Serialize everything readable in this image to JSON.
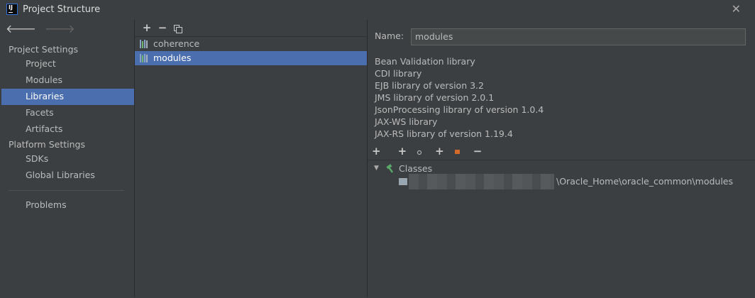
{
  "window": {
    "title": "Project Structure",
    "logo_text": "IJ"
  },
  "nav": {
    "back_icon": "arrow-left-icon",
    "forward_icon": "arrow-right-icon"
  },
  "sidebar": {
    "project_settings_header": "Project Settings",
    "project_settings_items": [
      {
        "label": "Project"
      },
      {
        "label": "Modules"
      },
      {
        "label": "Libraries",
        "selected": true
      },
      {
        "label": "Facets"
      },
      {
        "label": "Artifacts"
      }
    ],
    "platform_settings_header": "Platform Settings",
    "platform_settings_items": [
      {
        "label": "SDKs"
      },
      {
        "label": "Global Libraries"
      }
    ],
    "problems_label": "Problems"
  },
  "libraries": {
    "toolbar": {
      "add": "+",
      "remove": "−"
    },
    "items": [
      {
        "label": "coherence",
        "selected": false
      },
      {
        "label": "modules",
        "selected": true
      }
    ]
  },
  "details": {
    "name_label": "Name:",
    "name_value": "modules",
    "descriptions": [
      "Bean Validation library",
      "CDI library",
      "EJB library of version 3.2",
      "JMS library of version 2.0.1",
      "JsonProcessing library of version 1.0.4",
      "JAX-WS library",
      "JAX-RS library of version 1.19.4"
    ],
    "toolbar": {
      "add": "+",
      "add_with_settings": "+",
      "add_jar": "+",
      "remove": "−"
    },
    "tree": {
      "root_label": "Classes",
      "child_path": "\\Oracle_Home\\oracle_common\\modules"
    }
  },
  "colors": {
    "selection": "#4b6eaf",
    "background": "#3c3f41",
    "hammer": "#59a869"
  }
}
